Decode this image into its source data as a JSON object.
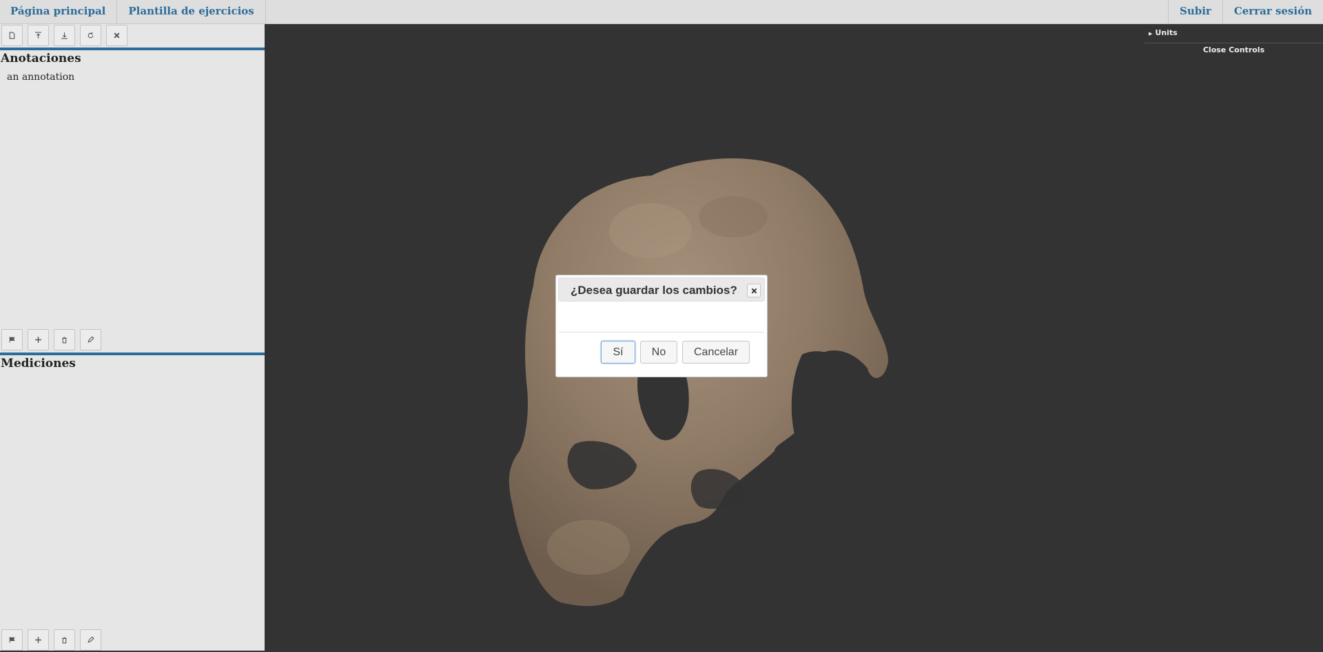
{
  "nav": {
    "left": [
      "Página principal",
      "Plantilla de ejercicios"
    ],
    "right": [
      "Subir",
      "Cerrar sesión"
    ]
  },
  "annotations": {
    "title": "Anotaciones",
    "items": [
      "an annotation"
    ]
  },
  "measurements": {
    "title": "Mediciones"
  },
  "toolbar_icons": [
    "new-file-icon",
    "upload-icon",
    "download-icon",
    "refresh-icon",
    "close-icon"
  ],
  "section_toolbar_icons": [
    "flag-icon",
    "plus-icon",
    "trash-icon",
    "pencil-icon"
  ],
  "controls": {
    "units_label": "Units",
    "close_label": "Close Controls"
  },
  "dialog": {
    "title": "¿Desea guardar los cambios?",
    "yes": "Sí",
    "no": "No",
    "cancel": "Cancelar"
  },
  "colors": {
    "accent": "#2b6c99",
    "viewport_bg": "#333333",
    "sidebar_bg": "#e6e6e6"
  }
}
